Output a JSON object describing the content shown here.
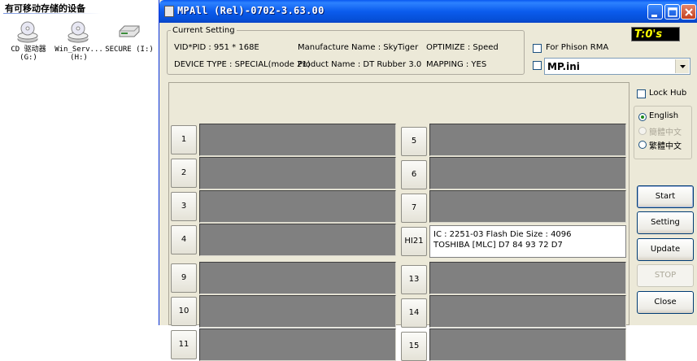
{
  "explorer": {
    "group_title": "有可移动存储的设备",
    "drives": [
      {
        "label_line1": "CD 驱动器",
        "label_line2": "(G:)",
        "icon": "cd-drive-icon"
      },
      {
        "label_line1": "Win_Serv...",
        "label_line2": "(H:)",
        "icon": "cd-drive-icon"
      },
      {
        "label_line1": "SECURE (I:)",
        "label_line2": "",
        "icon": "removable-disk-icon"
      }
    ]
  },
  "window": {
    "title": "MPAll (Rel)-0702-3.63.00",
    "controls": {
      "minimize": "minimize-icon",
      "maximize": "maximize-icon",
      "close": "close-icon"
    }
  },
  "current_setting": {
    "legend": "Current Setting",
    "vid_pid": "VID*PID :  951 * 168E",
    "manufacture": "Manufacture Name : SkyTiger",
    "optimize": "OPTIMIZE : Speed",
    "device_type": "DEVICE TYPE : SPECIAL(mode 21)",
    "product": "Product Name : DT Rubber 3.0",
    "mapping": "MAPPING : YES"
  },
  "options": {
    "timer": "T:0's",
    "phison_rma": "For Phison RMA",
    "ini_file": "MP.ini",
    "lock_hub": "Lock Hub"
  },
  "language": {
    "items": [
      {
        "label": "English",
        "selected": true,
        "disabled": false
      },
      {
        "label": "簡體中文",
        "selected": false,
        "disabled": true
      },
      {
        "label": "繁體中文",
        "selected": false,
        "disabled": false
      }
    ]
  },
  "ports": {
    "left": [
      {
        "label": "1"
      },
      {
        "label": "2"
      },
      {
        "label": "3"
      },
      {
        "label": "4"
      },
      {
        "label": "9"
      },
      {
        "label": "10"
      },
      {
        "label": "11"
      }
    ],
    "right": [
      {
        "label": "5"
      },
      {
        "label": "6"
      },
      {
        "label": "7"
      },
      {
        "label": "HI21",
        "info_line1": "IC : 2251-03  Flash Die Size : 4096",
        "info_line2": "TOSHIBA [MLC] D7 84 93 72 D7"
      },
      {
        "label": "13"
      },
      {
        "label": "14"
      },
      {
        "label": "15"
      }
    ]
  },
  "actions": {
    "start": "Start",
    "setting": "Setting",
    "update": "Update",
    "stop": "STOP",
    "close": "Close"
  }
}
